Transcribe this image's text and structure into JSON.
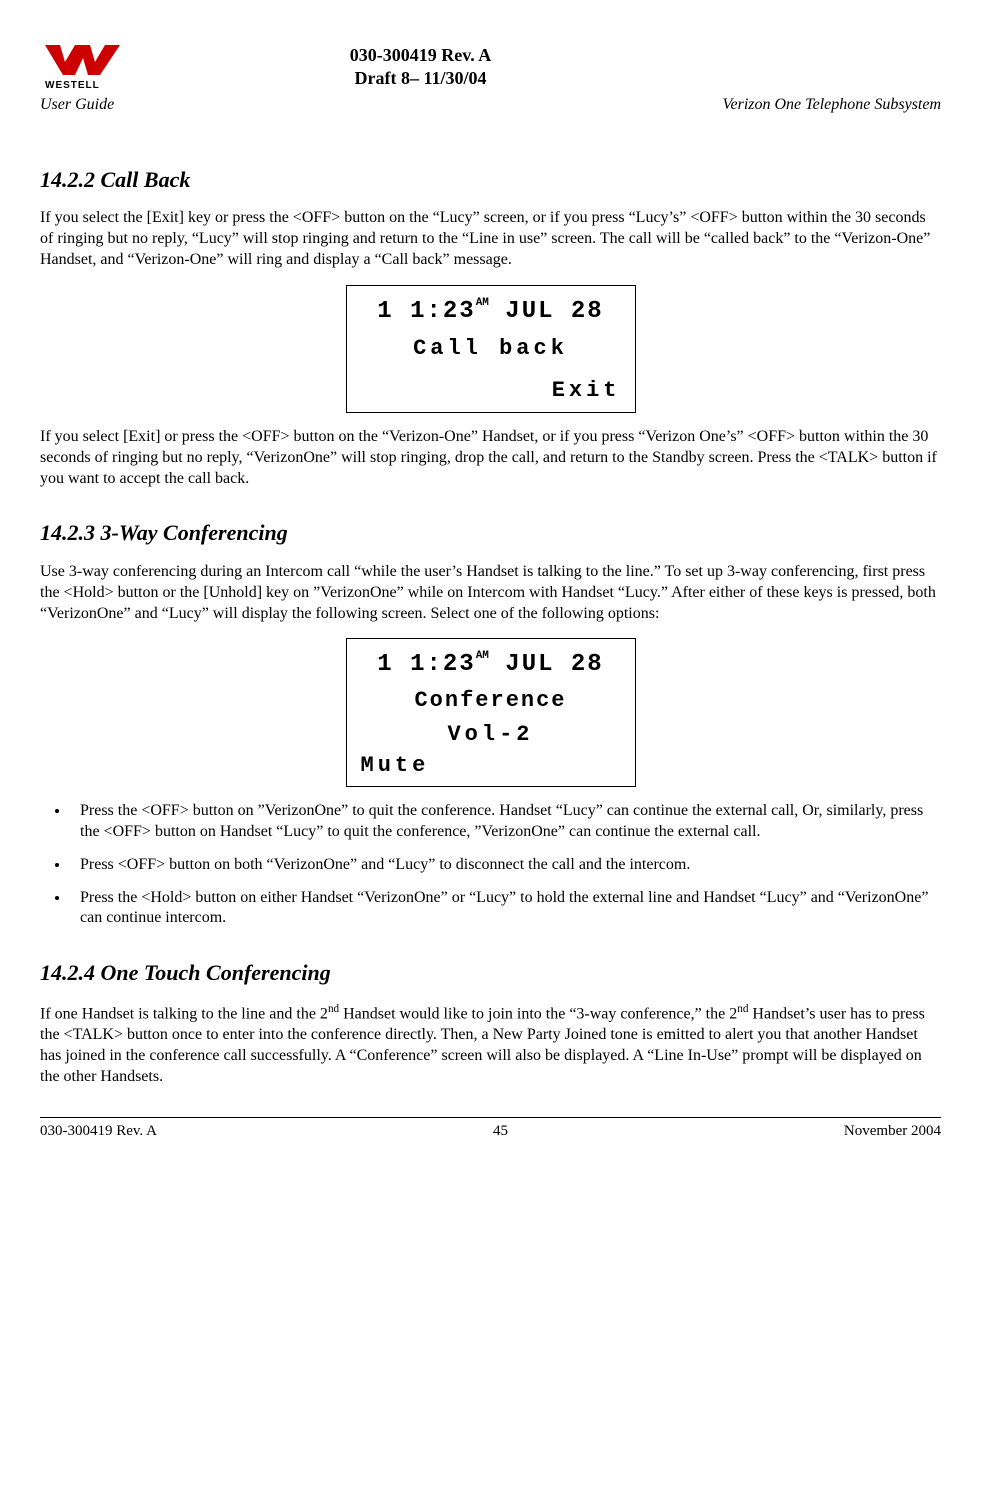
{
  "header": {
    "doc_id": "030-300419 Rev. A",
    "draft_line": "Draft 8– 11/30/04",
    "user_guide": "User Guide",
    "product": "Verizon One Telephone Subsystem"
  },
  "section_call_back": {
    "heading": "14.2.2 Call Back",
    "para1": "If you select the [Exit] key or press the <OFF> button on the “Lucy” screen, or if you press “Lucy’s” <OFF> button within the 30 seconds of ringing but no reply, “Lucy” will stop ringing and return to the “Line in use” screen. The call will be “called back” to the  “Verizon-One” Handset, and “Verizon-One” will ring and display a “Call back” message.",
    "lcd_time_hm": "1 1:23",
    "lcd_time_ampm": "AM",
    "lcd_time_date": " JUL 28",
    "lcd_line1": "Call back",
    "lcd_line2": "Exit",
    "para2": "If you select [Exit] or press the <OFF> button on the “Verizon-One” Handset, or if you press “Verizon One’s” <OFF> button within the 30 seconds of ringing but no reply,  “VerizonOne” will stop ringing, drop the call, and return to the Standby screen. Press the <TALK> button if you want to accept the call back."
  },
  "section_3way": {
    "heading": "14.2.3 3-Way Conferencing",
    "para1": "Use 3-way conferencing during an Intercom call  “while the user’s Handset is talking to the line.” To set up 3-way conferencing, first press the <Hold> button or the [Unhold] key on ”VerizonOne” while on Intercom with Handset “Lucy.” After either of these keys is pressed, both “VerizonOne” and “Lucy” will display the following screen. Select one of the following options:",
    "lcd_time_hm": "1 1:23",
    "lcd_time_ampm": "AM",
    "lcd_time_date": " JUL 28",
    "lcd_conf": "Conference",
    "lcd_vol": "Vol-2",
    "lcd_mute": "Mute",
    "bullets": [
      "Press the <OFF> button on ”VerizonOne” to quit the conference. Handset “Lucy” can continue the external call, Or, similarly, press the <OFF> button on Handset “Lucy” to quit the conference, ”VerizonOne” can continue the external call.",
      "Press <OFF> button on both  “VerizonOne” and “Lucy” to disconnect the call and the intercom.",
      "Press the <Hold> button on either Handset  “VerizonOne” or “Lucy” to hold the external line and Handset “Lucy” and “VerizonOne” can continue intercom."
    ]
  },
  "section_onetouch": {
    "heading": "14.2.4 One Touch Conferencing",
    "para_pre": "If one Handset is talking to the line and the 2",
    "para_sup1": "nd",
    "para_mid": " Handset would like to join into the “3-way conference,” the 2",
    "para_sup2": "nd",
    "para_post": " Handset’s user has to press the <TALK> button once to enter into the conference directly. Then, a New Party Joined tone is emitted to alert you that another Handset has joined in the conference call successfully. A “Conference” screen will also be displayed.  A “Line In-Use” prompt will be displayed on the other Handsets."
  },
  "footer": {
    "left": "030-300419 Rev. A",
    "center": "45",
    "right": "November 2004"
  }
}
